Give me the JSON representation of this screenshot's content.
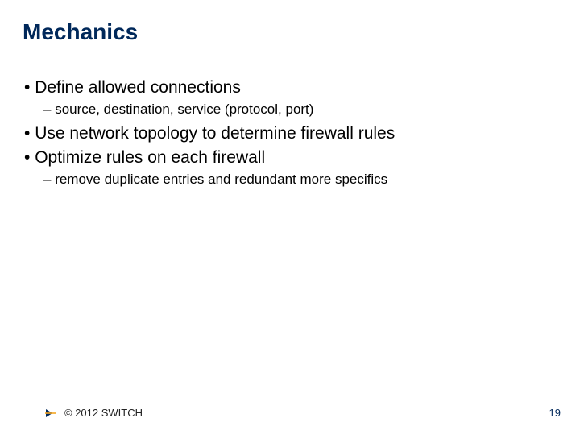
{
  "title": "Mechanics",
  "bullets": {
    "b1_0": "Define allowed connections",
    "b2_0": "source, destination, service (protocol, port)",
    "b1_1": "Use network topology to determine firewall rules",
    "b1_2": "Optimize rules on each firewall",
    "b2_1": "remove duplicate entries and redundant more specifics"
  },
  "footer": {
    "copyright": "© 2012 SWITCH",
    "page": "19"
  },
  "colors": {
    "title": "#00285a",
    "logo_blue": "#00285a",
    "logo_yellow": "#f5a623"
  }
}
